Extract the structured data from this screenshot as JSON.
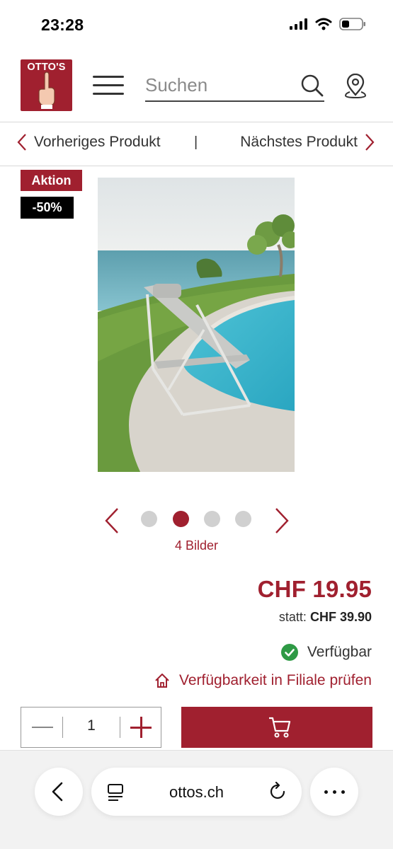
{
  "status_bar": {
    "time": "23:28"
  },
  "header": {
    "logo_text": "OTTO'S",
    "search_placeholder": "Suchen"
  },
  "product_nav": {
    "prev_label": "Vorheriges Produkt",
    "separator": "|",
    "next_label": "Nächstes Produkt"
  },
  "badges": {
    "promo": "Aktion",
    "discount": "-50%"
  },
  "gallery": {
    "image_count_label": "4 Bilder",
    "dots": 4,
    "active_index": 1
  },
  "pricing": {
    "price": "CHF 19.95",
    "old_price_prefix": "statt:",
    "old_price": "CHF 39.90"
  },
  "availability": {
    "status": "Verfügbar",
    "store_check": "Verfügbarkeit in Filiale prüfen"
  },
  "quantity": {
    "value": "1"
  },
  "browser": {
    "url": "ottos.ch"
  },
  "colors": {
    "brand": "#a0202f",
    "available": "#2e9a45"
  }
}
